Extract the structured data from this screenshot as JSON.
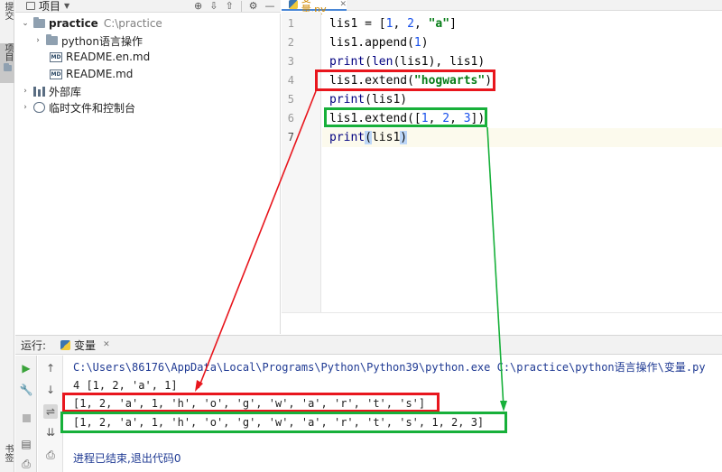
{
  "left_strip": {
    "top_tab": "提交",
    "project_tab": "项目",
    "bottom_tab": "书签"
  },
  "project_panel": {
    "title": "项目",
    "tree": [
      {
        "label": "practice",
        "path": "C:\\practice"
      },
      {
        "label": "python语言操作"
      },
      {
        "label": "README.en.md"
      },
      {
        "label": "README.md"
      },
      {
        "label": "外部库"
      },
      {
        "label": "临时文件和控制台"
      }
    ]
  },
  "editor": {
    "tab_name": "变量.py",
    "line_numbers": [
      "1",
      "2",
      "3",
      "4",
      "5",
      "6",
      "7"
    ],
    "current_line": 7
  },
  "run_panel": {
    "label": "运行:",
    "tab_name": "变量",
    "console": {
      "command": "C:\\Users\\86176\\AppData\\Local\\Programs\\Python\\Python39\\python.exe C:\\practice\\python语言操作\\变量.py",
      "out1": "4 [1, 2, 'a', 1]",
      "out2": "[1, 2, 'a', 1, 'h', 'o', 'g', 'w', 'a', 'r', 't', 's']",
      "out3": "[1, 2, 'a', 1, 'h', 'o', 'g', 'w', 'a', 'r', 't', 's', 1, 2, 3]",
      "exit": "进程已结束,退出代码0"
    }
  },
  "annotation_colors": {
    "red": "#e8161d",
    "green": "#17b03a"
  },
  "icons": [
    "project-folder-icon",
    "python-file-icon",
    "markdown-file-icon",
    "library-icon",
    "scratch-icon",
    "run-icon",
    "wrench-icon",
    "stop-icon",
    "soft-wrap-icon",
    "scroll-end-icon",
    "layout-icon",
    "print-icon",
    "gear-icon",
    "hide-icon",
    "locate-icon",
    "collapse-icon"
  ]
}
